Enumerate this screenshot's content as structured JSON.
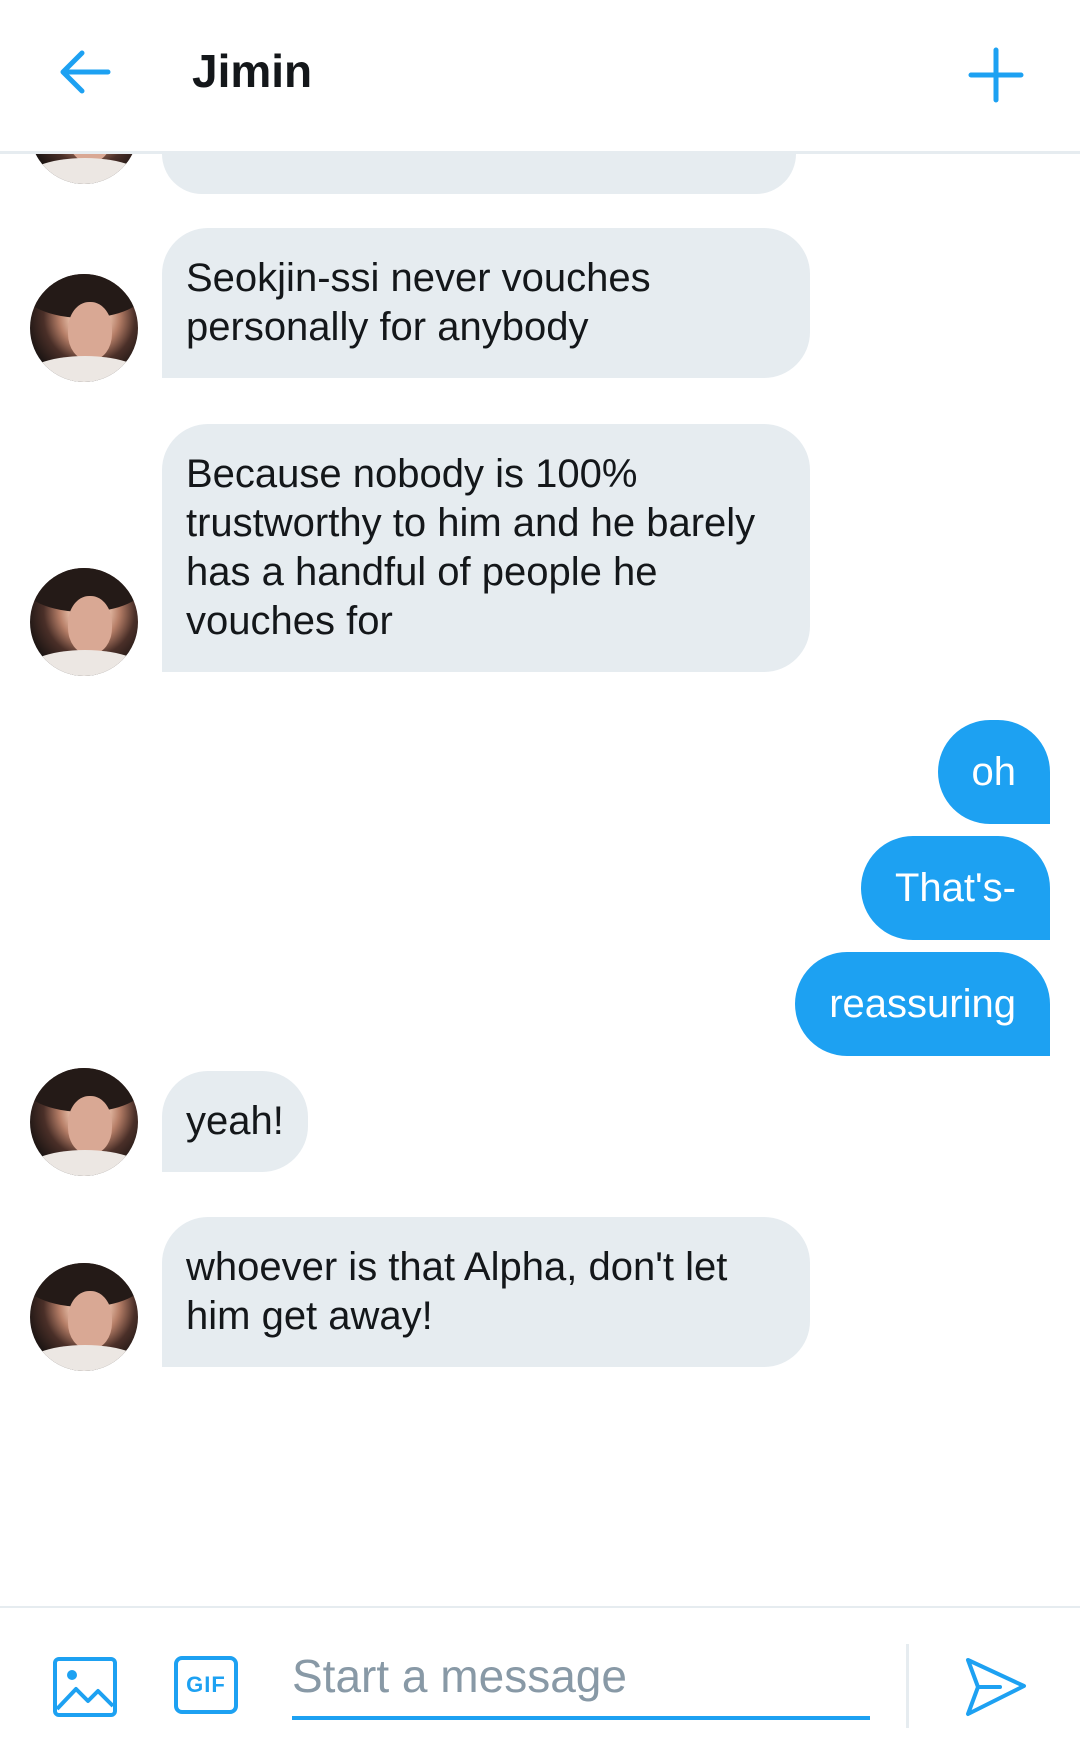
{
  "header": {
    "title": "Jimin",
    "back_icon": "arrow-left-icon",
    "add_icon": "plus-icon",
    "accent": "#1da1f2"
  },
  "messages": [
    {
      "from": "them",
      "text": "Seokjin-ssi never vouches personally for anybody"
    },
    {
      "from": "them",
      "text": "Because nobody is 100% trustworthy to him and he barely has a handful of people he vouches for"
    },
    {
      "from": "me",
      "text": "oh"
    },
    {
      "from": "me",
      "text": "That's-"
    },
    {
      "from": "me",
      "text": "reassuring"
    },
    {
      "from": "them",
      "text": "yeah!"
    },
    {
      "from": "them",
      "text": "whoever is that Alpha, don't let him get away!"
    }
  ],
  "composer": {
    "placeholder": "Start a message",
    "gif_label": "GIF",
    "image_icon": "image-icon",
    "send_icon": "send-icon"
  },
  "colors": {
    "incoming_bubble": "#e6ecf0",
    "outgoing_bubble": "#1da1f2",
    "text": "#14171a",
    "placeholder": "#8899a6"
  }
}
